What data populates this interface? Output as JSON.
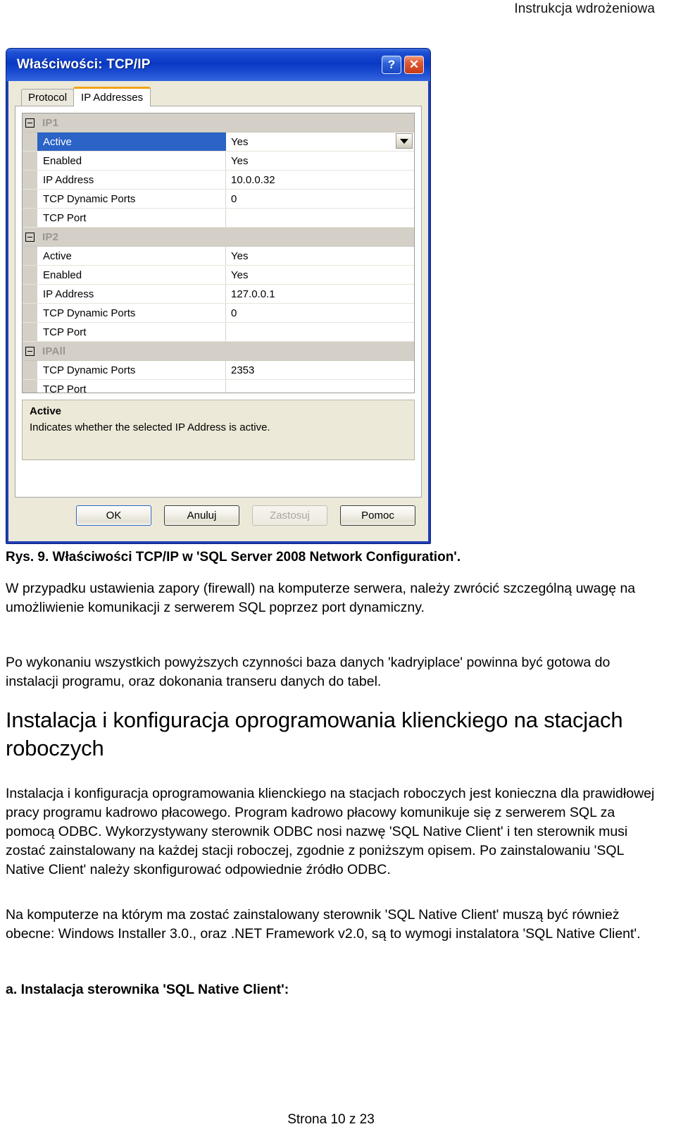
{
  "page": {
    "running_head": "Instrukcja wdrożeniowa",
    "footer": "Strona 10 z 23"
  },
  "dialog": {
    "title": "Właściwości: TCP/IP",
    "help_button": "?",
    "close_button": "✕",
    "tabs": [
      {
        "label": "Protocol",
        "selected": false
      },
      {
        "label": "IP Addresses",
        "selected": true
      }
    ],
    "grid": {
      "groups": [
        {
          "name": "IP1",
          "rows": [
            {
              "label": "Active",
              "value": "Yes",
              "selected": true,
              "has_dropdown": true
            },
            {
              "label": "Enabled",
              "value": "Yes",
              "selected": false,
              "has_dropdown": false
            },
            {
              "label": "IP Address",
              "value": "10.0.0.32",
              "selected": false,
              "has_dropdown": false
            },
            {
              "label": "TCP Dynamic Ports",
              "value": "0",
              "selected": false,
              "has_dropdown": false
            },
            {
              "label": "TCP Port",
              "value": "",
              "selected": false,
              "has_dropdown": false
            }
          ]
        },
        {
          "name": "IP2",
          "rows": [
            {
              "label": "Active",
              "value": "Yes",
              "selected": false,
              "has_dropdown": false
            },
            {
              "label": "Enabled",
              "value": "Yes",
              "selected": false,
              "has_dropdown": false
            },
            {
              "label": "IP Address",
              "value": "127.0.0.1",
              "selected": false,
              "has_dropdown": false
            },
            {
              "label": "TCP Dynamic Ports",
              "value": "0",
              "selected": false,
              "has_dropdown": false
            },
            {
              "label": "TCP Port",
              "value": "",
              "selected": false,
              "has_dropdown": false
            }
          ]
        },
        {
          "name": "IPAll",
          "rows": [
            {
              "label": "TCP Dynamic Ports",
              "value": "2353",
              "selected": false,
              "has_dropdown": false
            },
            {
              "label": "TCP Port",
              "value": "",
              "selected": false,
              "has_dropdown": false
            }
          ]
        }
      ]
    },
    "description": {
      "title": "Active",
      "text": "Indicates whether the selected IP Address is active."
    },
    "buttons": [
      {
        "label": "OK",
        "state": "default"
      },
      {
        "label": "Anuluj",
        "state": "normal"
      },
      {
        "label": "Zastosuj",
        "state": "disabled",
        "accel": "Z"
      },
      {
        "label": "Pomoc",
        "state": "normal"
      }
    ]
  },
  "document": {
    "figure_caption": "Rys. 9. Właściwości TCP/IP w 'SQL Server 2008 Network Configuration'.",
    "paragraph_1": "W przypadku ustawienia zapory (firewall) na komputerze serwera, należy zwrócić szczególną uwagę na umożliwienie komunikacji z serwerem SQL poprzez port dynamiczny.",
    "paragraph_2": "Po wykonaniu wszystkich powyższych czynności baza danych 'kadryiplace' powinna być gotowa do instalacji programu, oraz dokonania transeru danych do tabel.",
    "heading_1": "Instalacja i konfiguracja oprogramowania klienckiego na stacjach roboczych",
    "paragraph_3": "Instalacja i konfiguracja oprogramowania klienckiego na stacjach roboczych jest konieczna dla prawidłowej pracy programu kadrowo płacowego. Program kadrowo płacowy komunikuje się z serwerem SQL za pomocą ODBC. Wykorzystywany sterownik ODBC nosi nazwę 'SQL Native Client' i ten sterownik musi zostać zainstalowany na każdej stacji roboczej, zgodnie z poniższym opisem. Po zainstalowaniu 'SQL Native Client' należy skonfigurować odpowiednie źródło ODBC.",
    "paragraph_4": "Na komputerze na którym ma zostać zainstalowany sterownik 'SQL Native Client' muszą być również obecne: Windows Installer 3.0., oraz .NET Framework v2.0, są to wymogi instalatora 'SQL Native Client'.",
    "subheading_a": "a. Instalacja sterownika 'SQL Native Client':"
  }
}
